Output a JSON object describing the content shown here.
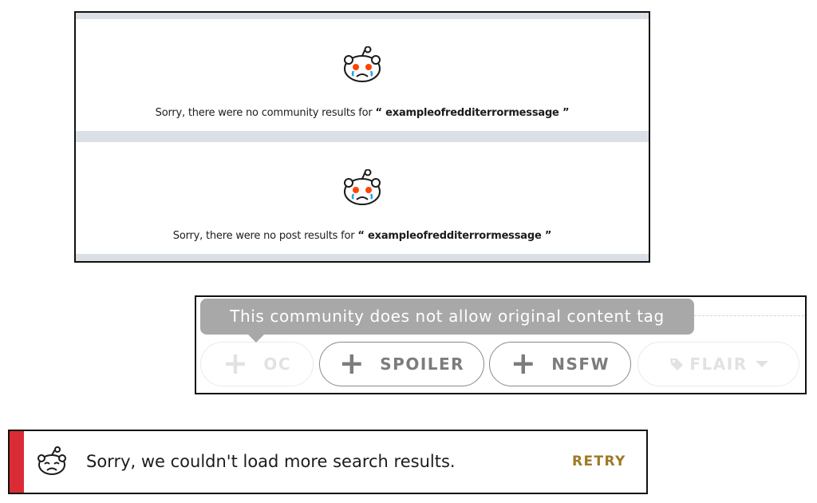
{
  "search_results": {
    "community_prefix": "Sorry, there were no community results for",
    "post_prefix": "Sorry, there were no post results for",
    "open_quote": "“ ",
    "query": "exampleofredditerrormessage",
    "close_quote": " ”"
  },
  "tag_bar": {
    "tooltip": "This community does not allow original content tag",
    "buttons": {
      "oc": {
        "label": "OC",
        "icon": "plus-icon",
        "state": "disabled"
      },
      "spoiler": {
        "label": "SPOILER",
        "icon": "plus-icon",
        "state": "enabled"
      },
      "nsfw": {
        "label": "NSFW",
        "icon": "plus-icon",
        "state": "enabled"
      },
      "flair": {
        "label": "FLAIR",
        "icon": "tag-icon",
        "state": "disabled"
      }
    }
  },
  "load_error": {
    "message": "Sorry, we couldn't load more search results.",
    "retry_label": "RETRY",
    "icon": "sad-snoo-icon"
  },
  "colors": {
    "error_accent": "#db2c36",
    "retry": "#9e7a26",
    "tooltip_bg": "#a8a8a8",
    "snoo_eyes": "#ff4500",
    "panel_divider": "#dae0e6"
  }
}
